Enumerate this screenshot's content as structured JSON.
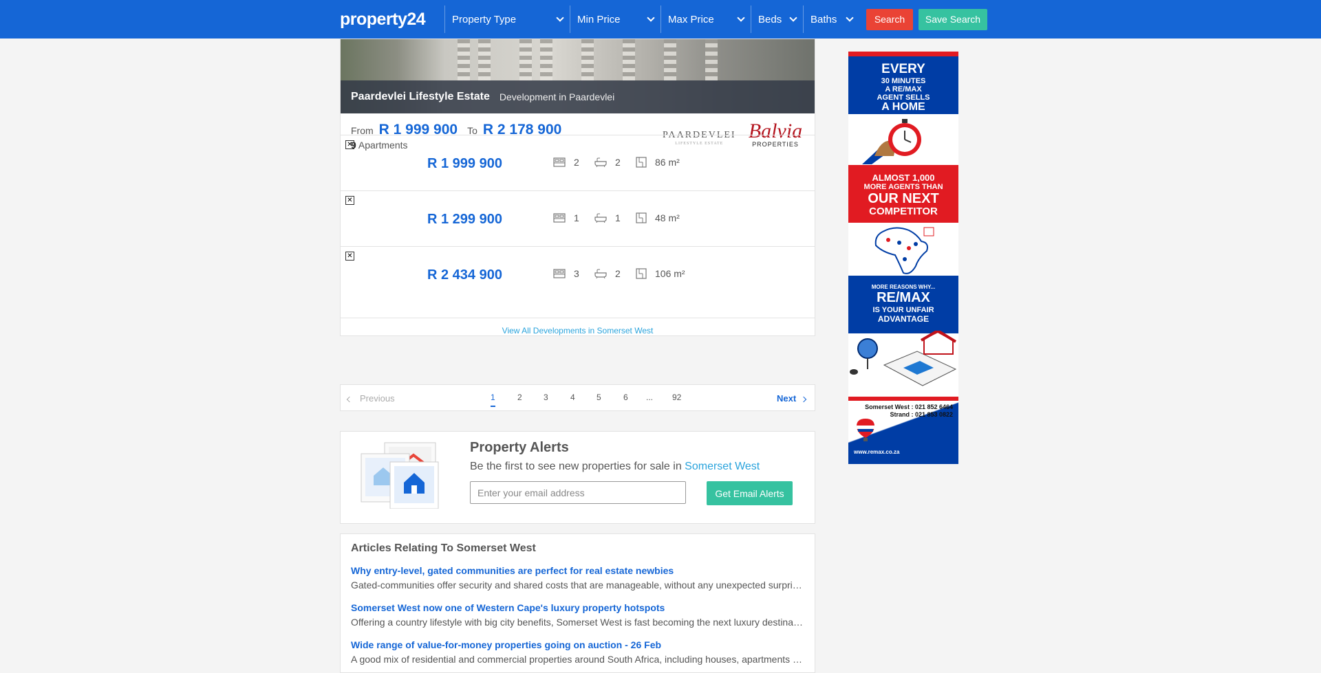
{
  "header": {
    "logo": "property24",
    "filters": {
      "property_type": "Property Type",
      "min_price": "Min Price",
      "max_price": "Max Price",
      "beds": "Beds",
      "baths": "Baths"
    },
    "search_label": "Search",
    "save_search_label": "Save Search",
    "color": "#1566d6"
  },
  "development": {
    "name": "Paardevlei Lifestyle Estate",
    "subtitle": "Development in Paardevlei",
    "from_label": "From",
    "from_price": "R 1 999 900",
    "to_label": "To",
    "to_price": "R 2 178 900",
    "count": "9",
    "type_label": "Apartments",
    "developer_logo": "PAARDEVLEI",
    "developer_logo_sub": "LIFESTYLE ESTATE",
    "agency_logo": "Balvia",
    "agency_logo_sub": "PROPERTIES",
    "units": [
      {
        "price": "R 1 999 900",
        "beds": "2",
        "baths": "2",
        "size": "86 m²"
      },
      {
        "price": "R 1 299 900",
        "beds": "1",
        "baths": "1",
        "size": "48 m²"
      },
      {
        "price": "R 2 434 900",
        "beds": "3",
        "baths": "2",
        "size": "106 m²"
      }
    ],
    "view_all": "View All Developments in Somerset West"
  },
  "pagination": {
    "previous": "Previous",
    "pages": [
      "1",
      "2",
      "3",
      "4",
      "5",
      "6",
      "...",
      "92"
    ],
    "current": "1",
    "next": "Next"
  },
  "alerts": {
    "title": "Property Alerts",
    "subtitle_prefix": "Be the first to see new properties for sale in",
    "location": "Somerset West",
    "email_placeholder": "Enter your email address",
    "button": "Get Email Alerts"
  },
  "articles": {
    "heading": "Articles Relating To Somerset West",
    "items": [
      {
        "title": "Why entry-level, gated communities are perfect for real estate newbies",
        "desc": "Gated-communities offer security and shared costs that are manageable, without any unexpected surprises..."
      },
      {
        "title": "Somerset West now one of Western Cape's luxury property hotspots",
        "desc": "Offering a country lifestyle with big city benefits, Somerset West is fast becoming the next luxury destination..."
      },
      {
        "title": "Wide range of value-for-money properties going on auction - 26 Feb",
        "desc": "A good mix of residential and commercial properties around South Africa, including houses, apartments and more..."
      }
    ]
  },
  "ad": {
    "line1": "EVERY",
    "line2": "30 MINUTES",
    "line3": "A RE/MAX",
    "line4": "AGENT SELLS",
    "line5": "A HOME",
    "line6": "ALMOST 1,000",
    "line7": "MORE AGENTS THAN",
    "line8": "OUR NEXT",
    "line9": "COMPETITOR",
    "line10": "MORE REASONS WHY...",
    "line11": "RE/MAX",
    "line12": "IS YOUR UNFAIR",
    "line13": "ADVANTAGE",
    "line14": "Somerset West : 021 852 6464",
    "line15": "Strand : 021 853 0822",
    "line16": "www.remax.co.za",
    "brand_red": "#e11b22",
    "brand_blue": "#003da5"
  }
}
